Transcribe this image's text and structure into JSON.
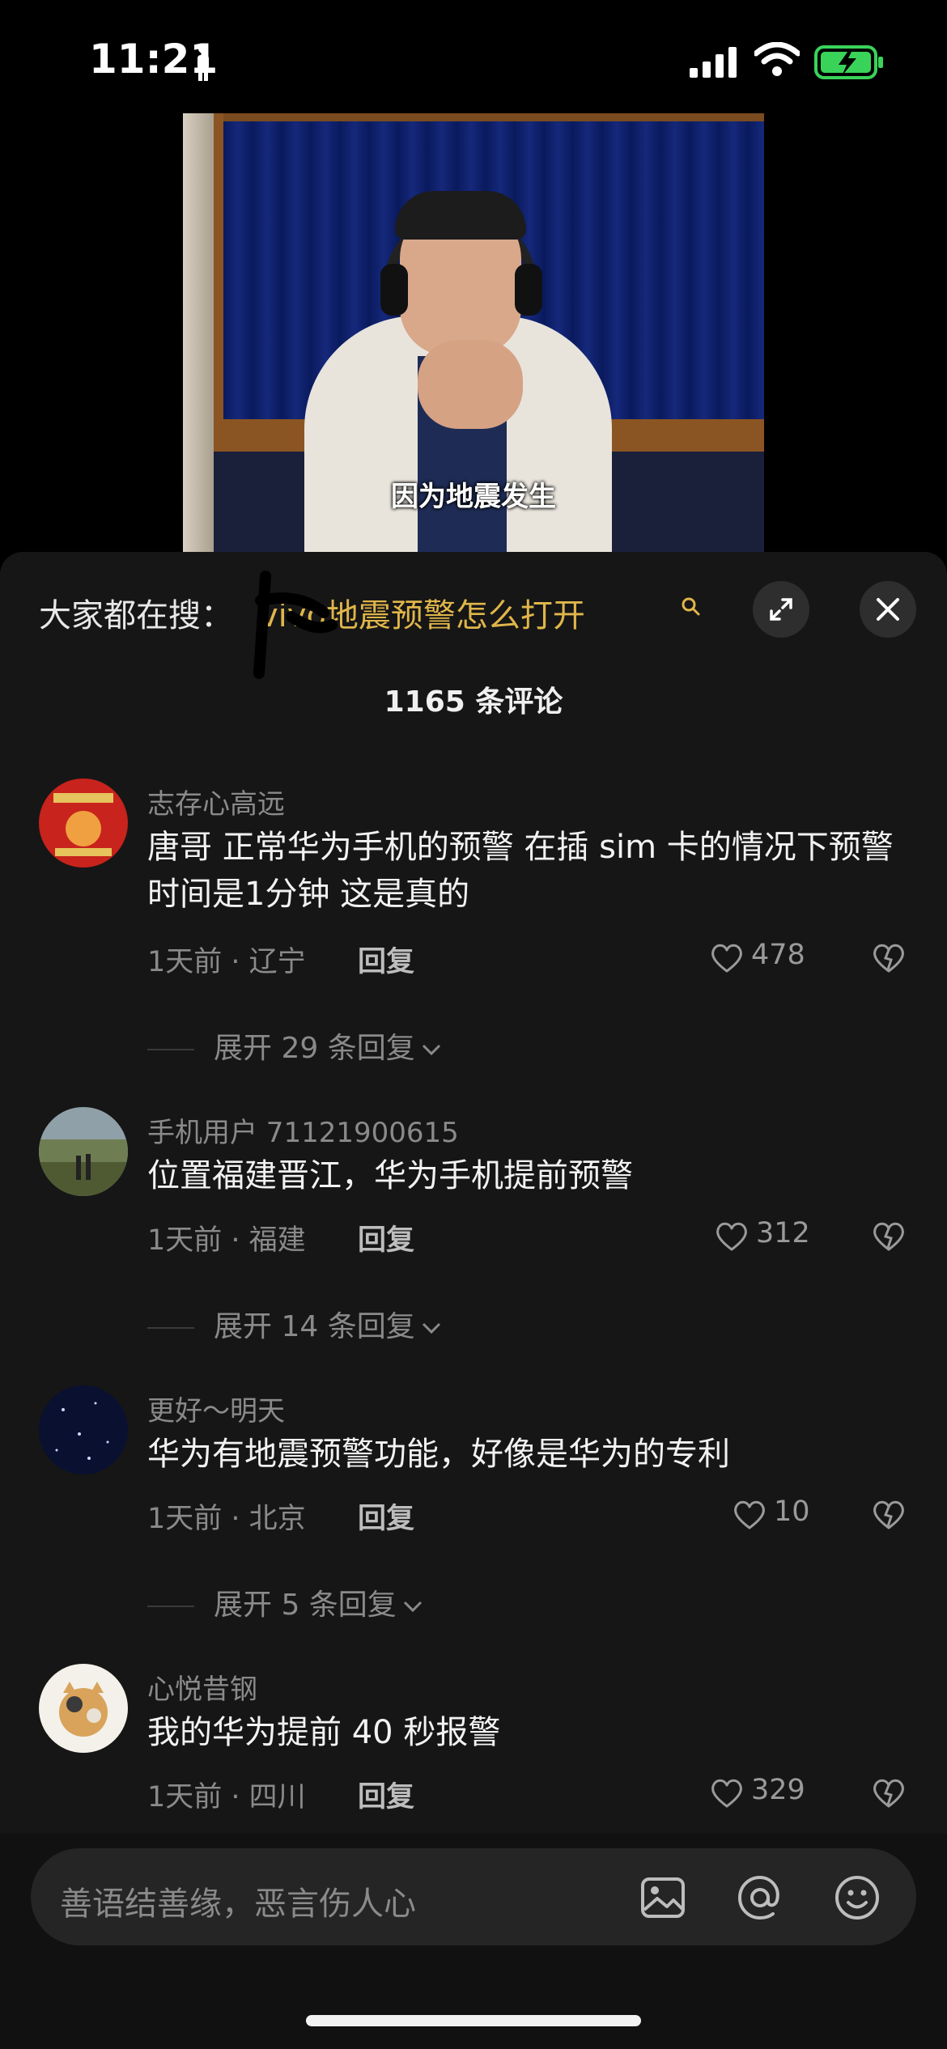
{
  "status_bar": {
    "time": "11:21"
  },
  "video": {
    "subtitle": "因为地震发生"
  },
  "search": {
    "prefix": "大家都在搜：",
    "term": "vivo地震预警怎么打开"
  },
  "comments_header": {
    "count_label": "1165 条评论"
  },
  "comments": [
    {
      "user": "志存心高远",
      "text": "唐哥 正常华为手机的预警 在插 sim 卡的情况下预警时间是1分钟 这是真的",
      "meta": "1天前 · 辽宁",
      "reply_label": "回复",
      "likes": "478",
      "expand_label": "展开 29 条回复"
    },
    {
      "user": "手机用户 71121900615",
      "text": "位置福建晋江，华为手机提前预警",
      "meta": "1天前 · 福建",
      "reply_label": "回复",
      "likes": "312",
      "expand_label": "展开 14 条回复"
    },
    {
      "user": "更好～明天",
      "text": "华为有地震预警功能，好像是华为的专利",
      "meta": "1天前 · 北京",
      "reply_label": "回复",
      "likes": "10",
      "expand_label": "展开 5 条回复"
    },
    {
      "user": "心悦昔钢",
      "text": "我的华为提前 40 秒报警",
      "meta": "1天前 · 四川",
      "reply_label": "回复",
      "likes": "329"
    }
  ],
  "input": {
    "placeholder": "善语结善缘，恶言伤人心"
  },
  "icons": {
    "status": [
      "person-icon",
      "signal-icon",
      "wifi-icon",
      "battery-charging-icon"
    ],
    "header": [
      "expand-icon",
      "close-icon"
    ],
    "comment": [
      "heart-icon",
      "dislike-icon",
      "chevron-down-icon"
    ],
    "input": [
      "image-icon",
      "at-icon",
      "emoji-icon"
    ]
  },
  "colors": {
    "accent_search": "#e0b64a",
    "battery": "#3ad35a",
    "sheet_bg": "#161616"
  }
}
